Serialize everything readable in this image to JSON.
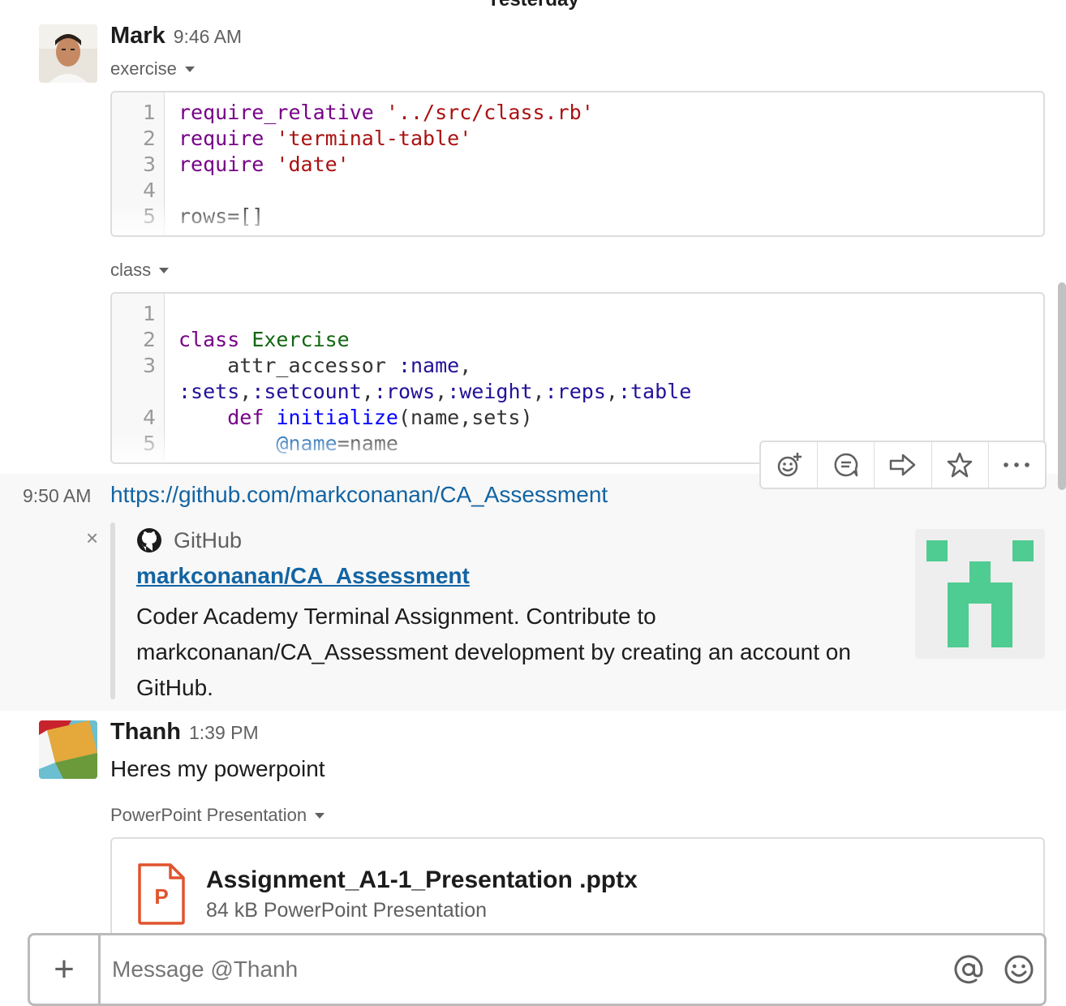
{
  "day_divider": "Yesterday",
  "messages": {
    "mark": {
      "sender": "Mark",
      "time": "9:46 AM",
      "snippet1": {
        "title": "exercise",
        "lines": [
          {
            "n": "1",
            "code": "require_relative '../src/class.rb'"
          },
          {
            "n": "2",
            "code": "require 'terminal-table'"
          },
          {
            "n": "3",
            "code": "require 'date'"
          },
          {
            "n": "4",
            "code": ""
          },
          {
            "n": "5",
            "code": "rows=[]"
          }
        ]
      },
      "snippet2": {
        "title": "class",
        "lines": [
          {
            "n": "1",
            "code": ""
          },
          {
            "n": "2",
            "code": "class Exercise"
          },
          {
            "n": "3",
            "code": "    attr_accessor :name,"
          },
          {
            "n": "",
            "code": ":sets,:setcount,:rows,:weight,:reps,:table"
          },
          {
            "n": "4",
            "code": "    def initialize(name,sets)"
          },
          {
            "n": "5",
            "code": "        @name=name"
          }
        ]
      }
    },
    "mark_followup": {
      "time": "9:50 AM",
      "link": "https://github.com/markconanan/CA_Assessment",
      "unfurl": {
        "service": "GitHub",
        "title": "markconanan/CA_Assessment",
        "description_lines": [
          "Coder Academy Terminal Assignment. Contribute to",
          "markconanan/CA_Assessment development by creating an account on",
          "GitHub."
        ],
        "close_glyph": "×"
      }
    },
    "thanh": {
      "sender": "Thanh",
      "time": "1:39 PM",
      "text": "Heres my powerpoint",
      "file_label": "PowerPoint Presentation",
      "file": {
        "name": "Assignment_A1-1_Presentation .pptx",
        "meta": "84 kB PowerPoint Presentation",
        "icon_letter": "P"
      }
    }
  },
  "hover_toolbar": {
    "icons": [
      "add-reaction-icon",
      "reply-thread-icon",
      "share-message-icon",
      "star-icon",
      "more-actions-icon"
    ]
  },
  "composer": {
    "plus_glyph": "+",
    "placeholder": "Message @Thanh"
  },
  "colors": {
    "link": "#1264a3",
    "identicon": "#4fcc91",
    "powerpoint": "#e0532e"
  }
}
